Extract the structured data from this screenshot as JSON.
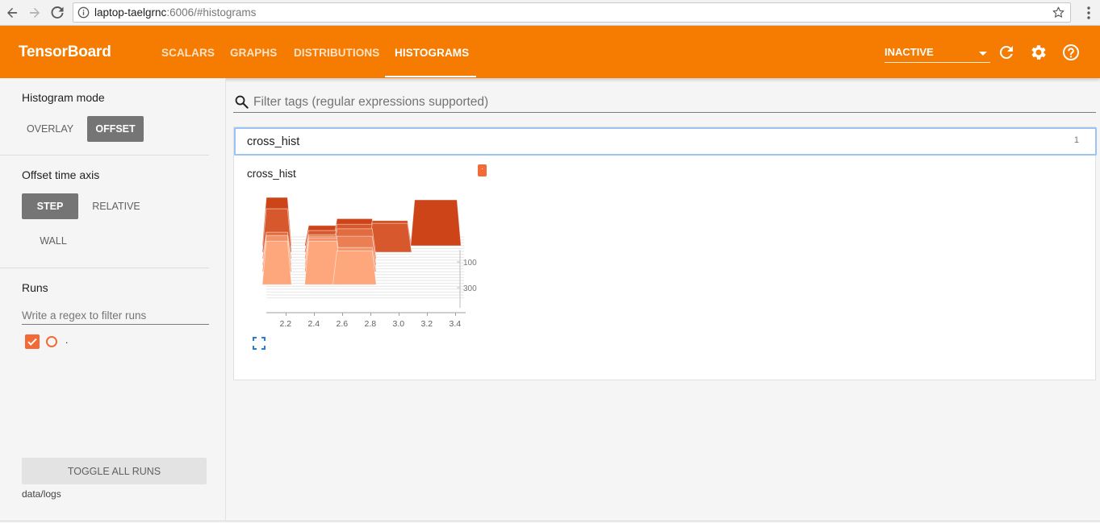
{
  "browser": {
    "url_host": "laptop-taelgrnc",
    "url_path": ":6006/#histograms"
  },
  "header": {
    "brand": "TensorBoard",
    "tabs": [
      {
        "label": "SCALARS"
      },
      {
        "label": "GRAPHS"
      },
      {
        "label": "DISTRIBUTIONS"
      },
      {
        "label": "HISTOGRAMS"
      }
    ],
    "active_tab": "HISTOGRAMS",
    "run_select": "INACTIVE"
  },
  "sidebar": {
    "histogram_mode_title": "Histogram mode",
    "mode_overlay": "OVERLAY",
    "mode_offset": "OFFSET",
    "mode_selected": "OFFSET",
    "offset_axis_title": "Offset time axis",
    "axis_step": "STEP",
    "axis_relative": "RELATIVE",
    "axis_wall": "WALL",
    "axis_selected": "STEP",
    "runs_title": "Runs",
    "runs_filter_placeholder": "Write a regex to filter runs",
    "runs": [
      {
        "name": ".",
        "checked": true
      }
    ],
    "toggle_all": "TOGGLE ALL RUNS",
    "logdir": "data/logs"
  },
  "main": {
    "tag_filter_placeholder": "Filter tags (regular expressions supported)",
    "category": {
      "name": "cross_hist",
      "count": "1"
    },
    "card": {
      "title": "cross_hist",
      "run_tag": "."
    }
  },
  "colors": {
    "toolbar": "#f57c00",
    "accent": "#f26b36",
    "selected_button": "#757575",
    "category_border": "#9bc4f4"
  },
  "chart_data": {
    "type": "area",
    "title": "cross_hist",
    "x_ticks": [
      "2.2",
      "2.4",
      "2.6",
      "2.8",
      "3.0",
      "3.2",
      "3.4"
    ],
    "x_range": [
      2.1,
      3.5
    ],
    "step_ticks": [
      "100",
      "300"
    ],
    "step_range": [
      0,
      500
    ],
    "mode": "offset",
    "grid": false,
    "legend": "none",
    "color_oldest": "#cd4418",
    "color_newest": "#ffa77c",
    "series": [
      {
        "step": 0,
        "bins": [
          {
            "from": 2.1,
            "to": 2.25,
            "count": 1
          },
          {
            "from": 2.4,
            "to": 2.6,
            "count": 0.42
          },
          {
            "from": 2.6,
            "to": 2.85,
            "count": 0.56
          },
          {
            "from": 2.85,
            "to": 3.1,
            "count": 0.52
          },
          {
            "from": 3.15,
            "to": 3.45,
            "count": 0.95
          }
        ]
      },
      {
        "step": 50,
        "bins": [
          {
            "from": 2.1,
            "to": 2.25,
            "count": 0.9
          },
          {
            "from": 2.4,
            "to": 2.6,
            "count": 0.45
          },
          {
            "from": 2.6,
            "to": 2.85,
            "count": 0.58
          },
          {
            "from": 2.85,
            "to": 3.1,
            "count": 0.6
          }
        ]
      },
      {
        "step": 100,
        "bins": [
          {
            "from": 2.1,
            "to": 2.25,
            "count": 0.55
          },
          {
            "from": 2.4,
            "to": 2.6,
            "count": 0.5
          },
          {
            "from": 2.6,
            "to": 2.85,
            "count": 0.62
          }
        ]
      },
      {
        "step": 150,
        "bins": [
          {
            "from": 2.1,
            "to": 2.25,
            "count": 0.6
          },
          {
            "from": 2.4,
            "to": 2.6,
            "count": 0.6
          },
          {
            "from": 2.6,
            "to": 2.85,
            "count": 0.6
          }
        ]
      },
      {
        "step": 200,
        "bins": [
          {
            "from": 2.1,
            "to": 2.25,
            "count": 0.75
          },
          {
            "from": 2.4,
            "to": 2.6,
            "count": 0.7
          },
          {
            "from": 2.6,
            "to": 2.85,
            "count": 0.5
          }
        ]
      },
      {
        "step": 300,
        "bins": [
          {
            "from": 2.1,
            "to": 2.25,
            "count": 0.9
          },
          {
            "from": 2.4,
            "to": 2.6,
            "count": 0.9
          },
          {
            "from": 2.6,
            "to": 2.85,
            "count": 0.7
          }
        ]
      }
    ]
  }
}
